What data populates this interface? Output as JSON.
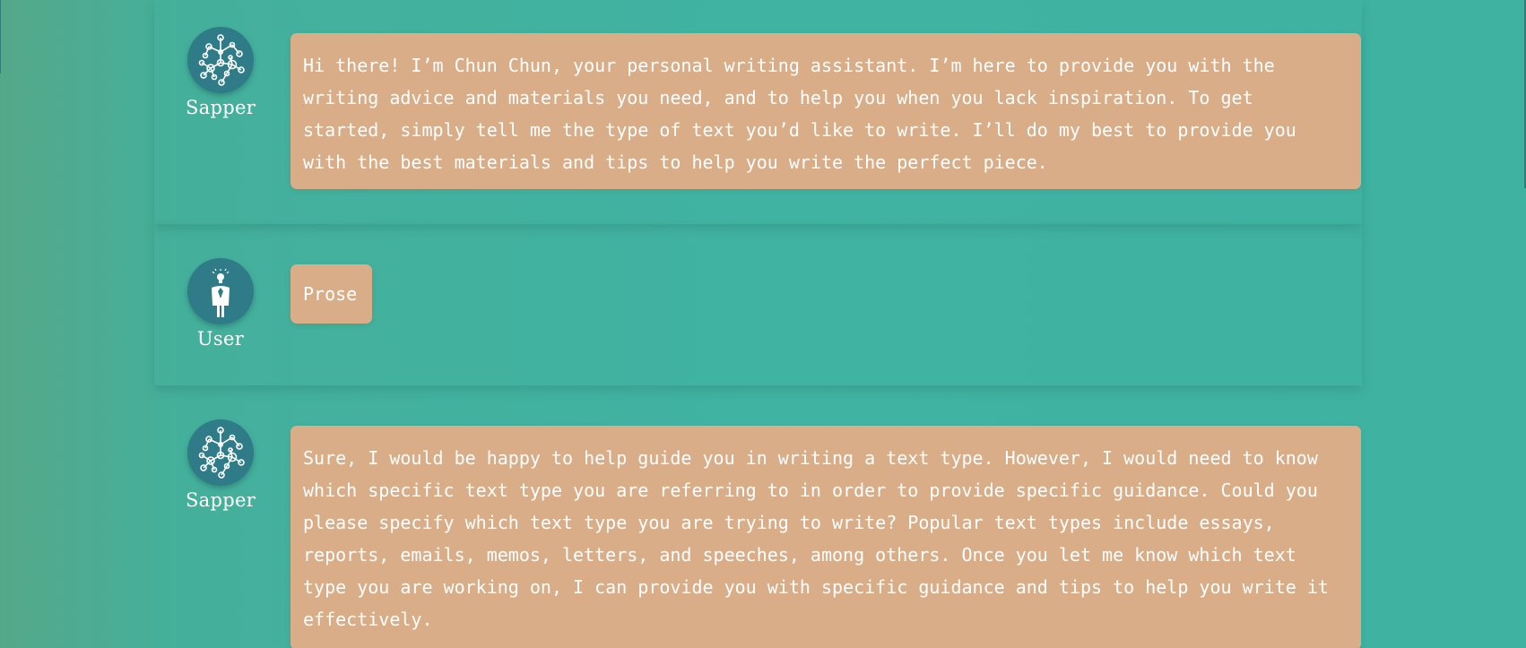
{
  "conversation": {
    "messages": [
      {
        "role": "Sapper",
        "avatar_icon": "network-nodes-icon",
        "text": "Hi there! I’m Chun Chun, your personal writing assistant. I’m here to provide you with the writing advice and materials you need, and to help you when you lack inspiration. To get started, simply tell me the type of text you’d like to write. I’ll do my best to provide you with the best materials and tips to help you write the perfect piece."
      },
      {
        "role": "User",
        "avatar_icon": "person-lightbulb-icon",
        "text": "Prose"
      },
      {
        "role": "Sapper",
        "avatar_icon": "network-nodes-icon",
        "text": "Sure, I would be happy to help guide you in writing a text type. However, I would need to know which specific text type you are referring to in order to provide specific guidance. Could you please specify which text type you are trying to write? Popular text types include essays, reports, emails, memos, letters, and speeches, among others. Once you let me know which text type you are working on, I can provide you with specific guidance and tips to help you write it effectively."
      }
    ]
  },
  "colors": {
    "background": "#40b3a2",
    "bubble": "#d8ad88",
    "avatar": "#2f7b87",
    "text": "#ffffff"
  }
}
